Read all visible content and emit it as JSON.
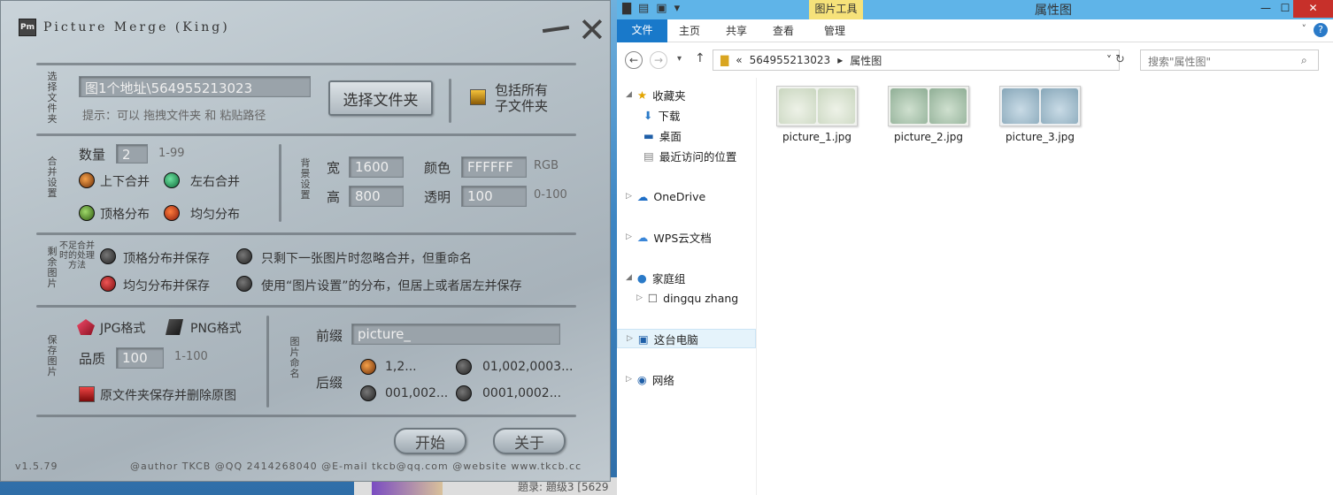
{
  "pm": {
    "title": "Picture Merge (King)",
    "logo": "Pm",
    "section_select": "选择文件夹",
    "path_value": "图1个地址\\564955213023",
    "hint": "提示：可以 拖拽文件夹 和 粘贴路径",
    "select_folder_button": "选择文件夹",
    "include_sub_label": "包括所有\n子文件夹",
    "section_merge": "合并设置",
    "count_label": "数量",
    "count_value": "2",
    "count_range": "1-99",
    "merge_vertical": "上下合并",
    "merge_horizontal": "左右合并",
    "dist_top": "顶格分布",
    "dist_even": "均匀分布",
    "section_bg": "背景设置",
    "width_label": "宽",
    "width_value": "1600",
    "height_label": "高",
    "height_value": "800",
    "color_label": "颜色",
    "color_value": "FFFFFF",
    "color_unit": "RGB",
    "opacity_label": "透明",
    "opacity_value": "100",
    "opacity_range": "0-100",
    "section_remain": "剩余图片",
    "section_remain_2": "不足合并时的处理方法",
    "remain_opt1": "顶格分布并保存",
    "remain_opt2": "只剩下一张图片时忽略合并，但重命名",
    "remain_opt3": "均匀分布并保存",
    "remain_opt4": "使用“图片设置”的分布，但居上或者居左并保存",
    "section_save": "保存图片",
    "jpg": "JPG格式",
    "png": "PNG格式",
    "quality_label": "品质",
    "quality_value": "100",
    "quality_range": "1-100",
    "save_delete": "原文件夹保存并删除原图",
    "section_naming": "图片命名",
    "prefix_label": "前缀",
    "prefix_value": "picture_",
    "suffix_label": "后缀",
    "suffix_1": "1,2...",
    "suffix_2": "01,002,0003...",
    "suffix_3": "001,002...",
    "suffix_4": "0001,0002...",
    "start_button": "开始",
    "about_button": "关于",
    "version": "v1.5.79",
    "footer": "@author TKCB   @QQ 2414268040   @E-mail tkcb@qq.com   @website www.tkcb.cc",
    "desk_text": "題录: 題级3 [5629"
  },
  "ex": {
    "picture_tools": "图片工具",
    "window_title": "属性图",
    "tabs": {
      "file": "文件",
      "home": "主页",
      "share": "共享",
      "view": "查看",
      "manage": "管理"
    },
    "address": {
      "prefix": "«",
      "folder": "564955213023",
      "sep": "▸",
      "current": "属性图"
    },
    "search_placeholder": "搜索\"属性图\"",
    "nav": {
      "favorites": "收藏夹",
      "downloads": "下载",
      "desktop": "桌面",
      "recent": "最近访问的位置",
      "onedrive": "OneDrive",
      "wps": "WPS云文档",
      "homegroup": "家庭组",
      "user": "dingqu zhang",
      "thispc": "这台电脑",
      "network": "网络"
    },
    "files": [
      "picture_1.jpg",
      "picture_2.jpg",
      "picture_3.jpg"
    ],
    "thumb_colors": [
      "#dfe6dc",
      "#b6c9b8",
      "#a9c0cf"
    ]
  }
}
